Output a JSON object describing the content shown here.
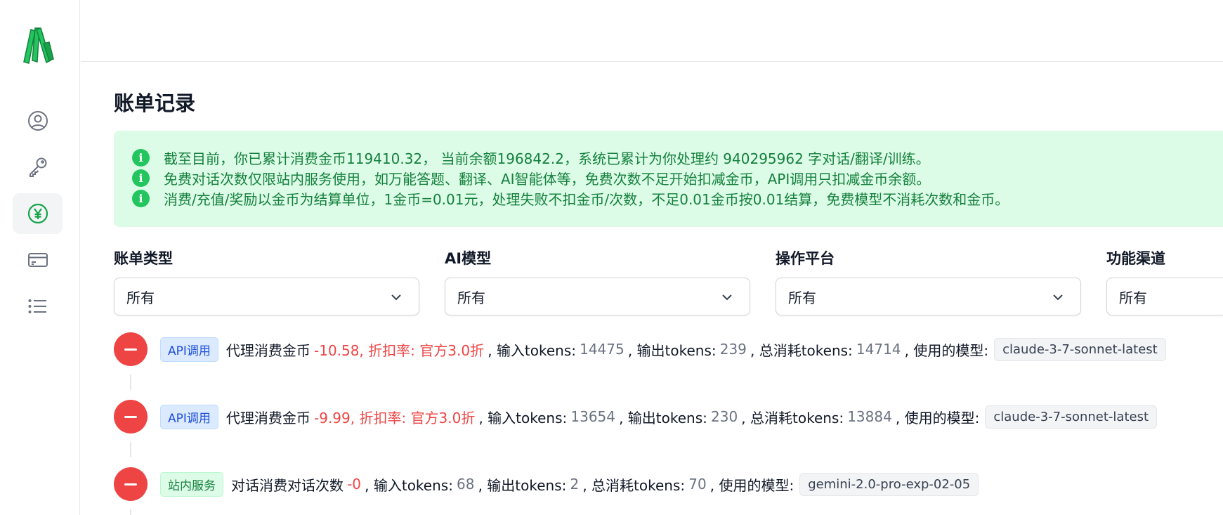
{
  "page": {
    "title": "账单记录"
  },
  "sidebar": {
    "items": [
      {
        "name": "profile",
        "icon": "user-circle-icon",
        "active": false
      },
      {
        "name": "api-keys",
        "icon": "key-icon",
        "active": false
      },
      {
        "name": "billing",
        "icon": "yen-circle-icon",
        "active": true
      },
      {
        "name": "payment",
        "icon": "credit-card-icon",
        "active": false
      },
      {
        "name": "list",
        "icon": "list-icon",
        "active": false
      }
    ]
  },
  "alert": {
    "lines": [
      "截至目前，你已累计消费金币119410.32， 当前余额196842.2，系统已累计为你处理约 940295962 字对话/翻译/训练。",
      "免费对话次数仅限站内服务使用，如万能答题、翻译、AI智能体等，免费次数不足开始扣减金币，API调用只扣减金币余额。",
      "消费/充值/奖励以金币为结算单位，1金币=0.01元，处理失败不扣金币/次数，不足0.01金币按0.01结算，免费模型不消耗次数和金币。"
    ]
  },
  "filters": [
    {
      "label": "账单类型",
      "value": "所有"
    },
    {
      "label": "AI模型",
      "value": "所有"
    },
    {
      "label": "操作平台",
      "value": "所有"
    },
    {
      "label": "功能渠道",
      "value": "所有"
    }
  ],
  "records": [
    {
      "tag": "API调用",
      "tag_type": "api",
      "desc": "代理消费金币",
      "amount": "-10.58, 折扣率: 官方3.0折",
      "input_label": ", 输入tokens:",
      "input": "14475",
      "output_label": ", 输出tokens:",
      "output": "239",
      "total_label": ", 总消耗tokens:",
      "total": "14714",
      "model_label": ", 使用的模型:",
      "model": "claude-3-7-sonnet-latest"
    },
    {
      "tag": "API调用",
      "tag_type": "api",
      "desc": "代理消费金币",
      "amount": "-9.99, 折扣率: 官方3.0折",
      "input_label": ", 输入tokens:",
      "input": "13654",
      "output_label": ", 输出tokens:",
      "output": "230",
      "total_label": ", 总消耗tokens:",
      "total": "13884",
      "model_label": ", 使用的模型:",
      "model": "claude-3-7-sonnet-latest"
    },
    {
      "tag": "站内服务",
      "tag_type": "site",
      "desc": "对话消费对话次数",
      "amount": "-0",
      "input_label": ", 输入tokens:",
      "input": "68",
      "output_label": ", 输出tokens:",
      "output": "2",
      "total_label": ", 总消耗tokens:",
      "total": "70",
      "model_label": ", 使用的模型:",
      "model": "gemini-2.0-pro-exp-02-05"
    }
  ]
}
